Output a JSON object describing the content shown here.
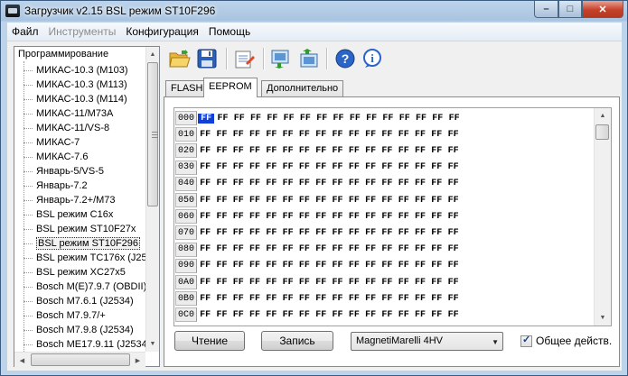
{
  "window": {
    "title": "Загрузчик v2.15 BSL режим ST10F296",
    "controls": [
      "–",
      "□",
      "✕"
    ]
  },
  "menu": [
    "Файл",
    "Инструменты",
    "Конфигурация",
    "Помощь"
  ],
  "menu_disabled": [
    false,
    true,
    false,
    false
  ],
  "tree": {
    "root": "Программирование",
    "items": [
      "МИКАС-10.3 (М103)",
      "МИКАС-10.3 (М113)",
      "МИКАС-10.3 (М114)",
      "МИКАС-11/М73А",
      "МИКАС-11/VS-8",
      "МИКАС-7",
      "МИКАС-7.6",
      "Январь-5/VS-5",
      "Январь-7.2",
      "Январь-7.2+/М73",
      "BSL режим C16x",
      "BSL режим ST10F27x",
      "BSL режим ST10F296",
      "BSL режим TC176x (J25",
      "BSL режим XC27x5",
      "Bosch M(E)7.9.7 (OBDII)",
      "Bosch M7.6.1 (J2534)",
      "Bosch M7.9.7/+",
      "Bosch M7.9.8 (J2534)",
      "Bosch ME17.9.11 (J2534"
    ],
    "selected_index": 12
  },
  "toolbar": {
    "buttons": [
      "open-folder-icon",
      "save-icon",
      "settings-icon",
      "read-ecu-icon",
      "write-ecu-icon",
      "help-icon",
      "info-icon"
    ]
  },
  "tabs": [
    "FLASH",
    "EEPROM",
    "Дополнительно"
  ],
  "active_tab": 1,
  "hex": {
    "addresses": [
      "000",
      "010",
      "020",
      "030",
      "040",
      "050",
      "060",
      "070",
      "080",
      "090",
      "0A0",
      "0B0",
      "0C0"
    ],
    "byte": "FF",
    "bytes_per_row": 16,
    "selected": {
      "row": 0,
      "col": 0
    }
  },
  "buttons": {
    "read": "Чтение",
    "write": "Запись"
  },
  "ecu_select": {
    "value": "MagnetiMarelli 4HV"
  },
  "checkbox": {
    "label": "Общее действ.",
    "checked": true
  },
  "colors": {
    "selection": "#0f3fd8",
    "titlebar": "#a9c4e1",
    "close_button": "#c6412a"
  }
}
